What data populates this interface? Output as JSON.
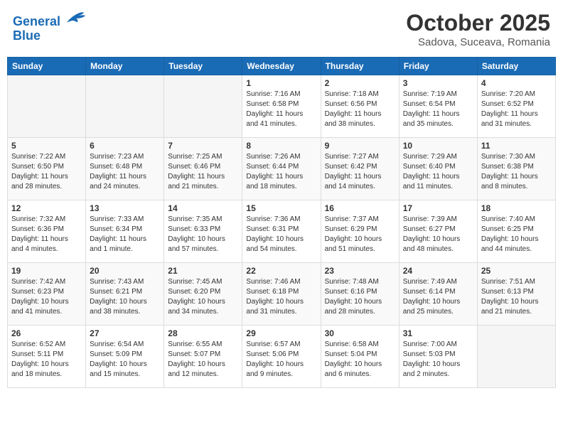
{
  "header": {
    "logo_line1": "General",
    "logo_line2": "Blue",
    "month_title": "October 2025",
    "location": "Sadova, Suceava, Romania"
  },
  "weekdays": [
    "Sunday",
    "Monday",
    "Tuesday",
    "Wednesday",
    "Thursday",
    "Friday",
    "Saturday"
  ],
  "weeks": [
    [
      {
        "day": "",
        "info": ""
      },
      {
        "day": "",
        "info": ""
      },
      {
        "day": "",
        "info": ""
      },
      {
        "day": "1",
        "info": "Sunrise: 7:16 AM\nSunset: 6:58 PM\nDaylight: 11 hours and 41 minutes."
      },
      {
        "day": "2",
        "info": "Sunrise: 7:18 AM\nSunset: 6:56 PM\nDaylight: 11 hours and 38 minutes."
      },
      {
        "day": "3",
        "info": "Sunrise: 7:19 AM\nSunset: 6:54 PM\nDaylight: 11 hours and 35 minutes."
      },
      {
        "day": "4",
        "info": "Sunrise: 7:20 AM\nSunset: 6:52 PM\nDaylight: 11 hours and 31 minutes."
      }
    ],
    [
      {
        "day": "5",
        "info": "Sunrise: 7:22 AM\nSunset: 6:50 PM\nDaylight: 11 hours and 28 minutes."
      },
      {
        "day": "6",
        "info": "Sunrise: 7:23 AM\nSunset: 6:48 PM\nDaylight: 11 hours and 24 minutes."
      },
      {
        "day": "7",
        "info": "Sunrise: 7:25 AM\nSunset: 6:46 PM\nDaylight: 11 hours and 21 minutes."
      },
      {
        "day": "8",
        "info": "Sunrise: 7:26 AM\nSunset: 6:44 PM\nDaylight: 11 hours and 18 minutes."
      },
      {
        "day": "9",
        "info": "Sunrise: 7:27 AM\nSunset: 6:42 PM\nDaylight: 11 hours and 14 minutes."
      },
      {
        "day": "10",
        "info": "Sunrise: 7:29 AM\nSunset: 6:40 PM\nDaylight: 11 hours and 11 minutes."
      },
      {
        "day": "11",
        "info": "Sunrise: 7:30 AM\nSunset: 6:38 PM\nDaylight: 11 hours and 8 minutes."
      }
    ],
    [
      {
        "day": "12",
        "info": "Sunrise: 7:32 AM\nSunset: 6:36 PM\nDaylight: 11 hours and 4 minutes."
      },
      {
        "day": "13",
        "info": "Sunrise: 7:33 AM\nSunset: 6:34 PM\nDaylight: 11 hours and 1 minute."
      },
      {
        "day": "14",
        "info": "Sunrise: 7:35 AM\nSunset: 6:33 PM\nDaylight: 10 hours and 57 minutes."
      },
      {
        "day": "15",
        "info": "Sunrise: 7:36 AM\nSunset: 6:31 PM\nDaylight: 10 hours and 54 minutes."
      },
      {
        "day": "16",
        "info": "Sunrise: 7:37 AM\nSunset: 6:29 PM\nDaylight: 10 hours and 51 minutes."
      },
      {
        "day": "17",
        "info": "Sunrise: 7:39 AM\nSunset: 6:27 PM\nDaylight: 10 hours and 48 minutes."
      },
      {
        "day": "18",
        "info": "Sunrise: 7:40 AM\nSunset: 6:25 PM\nDaylight: 10 hours and 44 minutes."
      }
    ],
    [
      {
        "day": "19",
        "info": "Sunrise: 7:42 AM\nSunset: 6:23 PM\nDaylight: 10 hours and 41 minutes."
      },
      {
        "day": "20",
        "info": "Sunrise: 7:43 AM\nSunset: 6:21 PM\nDaylight: 10 hours and 38 minutes."
      },
      {
        "day": "21",
        "info": "Sunrise: 7:45 AM\nSunset: 6:20 PM\nDaylight: 10 hours and 34 minutes."
      },
      {
        "day": "22",
        "info": "Sunrise: 7:46 AM\nSunset: 6:18 PM\nDaylight: 10 hours and 31 minutes."
      },
      {
        "day": "23",
        "info": "Sunrise: 7:48 AM\nSunset: 6:16 PM\nDaylight: 10 hours and 28 minutes."
      },
      {
        "day": "24",
        "info": "Sunrise: 7:49 AM\nSunset: 6:14 PM\nDaylight: 10 hours and 25 minutes."
      },
      {
        "day": "25",
        "info": "Sunrise: 7:51 AM\nSunset: 6:13 PM\nDaylight: 10 hours and 21 minutes."
      }
    ],
    [
      {
        "day": "26",
        "info": "Sunrise: 6:52 AM\nSunset: 5:11 PM\nDaylight: 10 hours and 18 minutes."
      },
      {
        "day": "27",
        "info": "Sunrise: 6:54 AM\nSunset: 5:09 PM\nDaylight: 10 hours and 15 minutes."
      },
      {
        "day": "28",
        "info": "Sunrise: 6:55 AM\nSunset: 5:07 PM\nDaylight: 10 hours and 12 minutes."
      },
      {
        "day": "29",
        "info": "Sunrise: 6:57 AM\nSunset: 5:06 PM\nDaylight: 10 hours and 9 minutes."
      },
      {
        "day": "30",
        "info": "Sunrise: 6:58 AM\nSunset: 5:04 PM\nDaylight: 10 hours and 6 minutes."
      },
      {
        "day": "31",
        "info": "Sunrise: 7:00 AM\nSunset: 5:03 PM\nDaylight: 10 hours and 2 minutes."
      },
      {
        "day": "",
        "info": ""
      }
    ]
  ]
}
